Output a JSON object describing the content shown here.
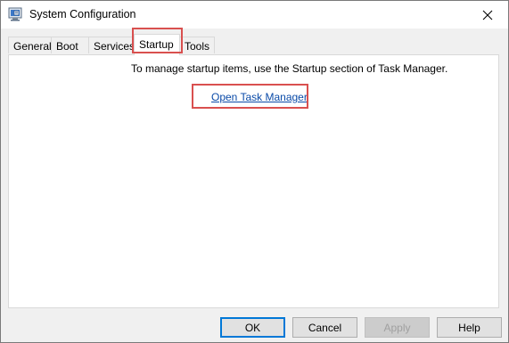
{
  "window": {
    "title": "System Configuration",
    "icon": "msconfig-app-icon",
    "close_icon": "close-icon"
  },
  "tabs": [
    {
      "label": "General",
      "active": false
    },
    {
      "label": "Boot",
      "active": false
    },
    {
      "label": "Services",
      "active": false
    },
    {
      "label": "Startup",
      "active": true
    },
    {
      "label": "Tools",
      "active": false
    }
  ],
  "startup_panel": {
    "message": "To manage startup items, use the Startup section of Task Manager.",
    "link_label": "Open Task Manager"
  },
  "buttons": {
    "ok": "OK",
    "cancel": "Cancel",
    "apply": "Apply",
    "help": "Help"
  },
  "colors": {
    "highlight": "#d9504f",
    "link": "#0a4aa8",
    "default_button_border": "#0078d7"
  }
}
